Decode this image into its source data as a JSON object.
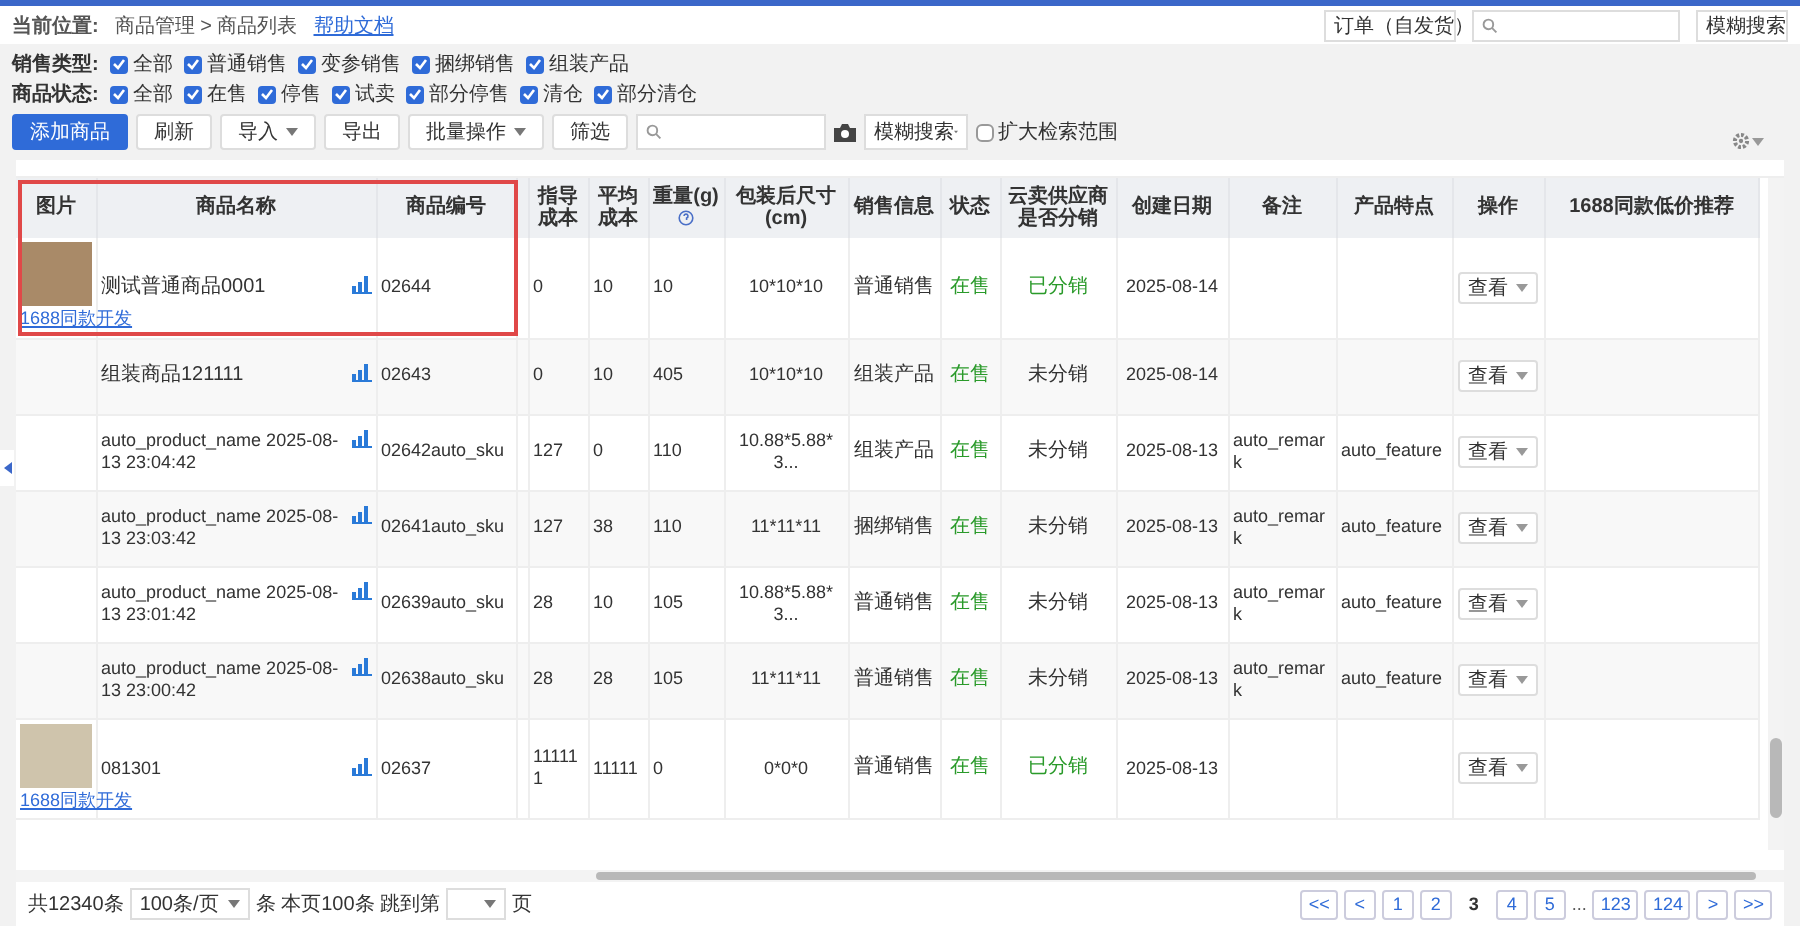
{
  "breadcrumb": {
    "label": "当前位置:",
    "path": "商品管理 > 商品列表",
    "help_link": "帮助文档"
  },
  "top_search": {
    "scope": "订单（自发货）",
    "mode": "模糊搜索"
  },
  "filters": [
    {
      "label": "销售类型:",
      "options": [
        {
          "text": "全部",
          "checked": true
        },
        {
          "text": "普通销售",
          "checked": true
        },
        {
          "text": "变参销售",
          "checked": true
        },
        {
          "text": "捆绑销售",
          "checked": true
        },
        {
          "text": "组装产品",
          "checked": true
        }
      ]
    },
    {
      "label": "商品状态:",
      "options": [
        {
          "text": "全部",
          "checked": true
        },
        {
          "text": "在售",
          "checked": true
        },
        {
          "text": "停售",
          "checked": true
        },
        {
          "text": "试卖",
          "checked": true
        },
        {
          "text": "部分停售",
          "checked": true
        },
        {
          "text": "清仓",
          "checked": true
        },
        {
          "text": "部分清仓",
          "checked": true
        }
      ]
    }
  ],
  "toolbar": {
    "buttons": [
      {
        "text": "添加商品",
        "kind": "primary"
      },
      {
        "text": "刷新",
        "kind": "plain"
      },
      {
        "text": "导入",
        "kind": "dropdown"
      },
      {
        "text": "导出",
        "kind": "plain"
      },
      {
        "text": "批量操作",
        "kind": "dropdown"
      },
      {
        "text": "筛选",
        "kind": "plain"
      }
    ],
    "search_mode": "模糊搜索",
    "expand": {
      "text": "扩大检索范围",
      "checked": false
    }
  },
  "table": {
    "columns": [
      {
        "label": "图片"
      },
      {
        "label": "商品名称"
      },
      {
        "label": "商品编号"
      },
      {},
      {
        "label": "指导成本"
      },
      {
        "label": "平均成本"
      },
      {
        "label": "重量(g)",
        "help": true
      },
      {
        "label": "包装后尺寸 (cm)"
      },
      {
        "label": "销售信息"
      },
      {
        "label": "状态"
      },
      {
        "label": "云卖供应商是否分销"
      },
      {
        "label": "创建日期"
      },
      {
        "label": "备注"
      },
      {
        "label": "产品特点"
      },
      {
        "label": "操作"
      },
      {
        "label": "1688同款低价推荐"
      }
    ],
    "rows": [
      {
        "photo": true,
        "link": "1688同款开发",
        "name": "测试普通商品0001",
        "sku": "02644",
        "guide_cost": "0",
        "avg_cost": "10",
        "weight": "10",
        "size": "10*10*10",
        "sales": "普通销售",
        "status": {
          "text": "在售",
          "on_sale": true
        },
        "distribution": {
          "text": "已分销",
          "distributed": true
        },
        "created": "2025-08-14",
        "action": "查看"
      },
      {
        "photo": false,
        "name": "组装商品121111",
        "sku": "02643",
        "guide_cost": "0",
        "avg_cost": "10",
        "weight": "405",
        "size": "10*10*10",
        "sales": "组装产品",
        "status": {
          "text": "在售",
          "on_sale": true
        },
        "distribution": {
          "text": "未分销",
          "distributed": false
        },
        "created": "2025-08-14",
        "action": "查看"
      },
      {
        "photo": false,
        "name": "auto_product_name 2025-08-13 23:04:42",
        "sku": "02642auto_sku",
        "guide_cost": "127",
        "avg_cost": "0",
        "weight": "110",
        "size": "10.88*5.88*3...",
        "sales": "组装产品",
        "status": {
          "text": "在售",
          "on_sale": true
        },
        "distribution": {
          "text": "未分销",
          "distributed": false
        },
        "created": "2025-08-13",
        "remark": "auto_remark",
        "feature": "auto_feature",
        "action": "查看"
      },
      {
        "photo": false,
        "name": "auto_product_name 2025-08-13 23:03:42",
        "sku": "02641auto_sku",
        "guide_cost": "127",
        "avg_cost": "38",
        "weight": "110",
        "size": "11*11*11",
        "sales": "捆绑销售",
        "status": {
          "text": "在售",
          "on_sale": true
        },
        "distribution": {
          "text": "未分销",
          "distributed": false
        },
        "created": "2025-08-13",
        "remark": "auto_remark",
        "feature": "auto_feature",
        "action": "查看"
      },
      {
        "photo": false,
        "name": "auto_product_name 2025-08-13 23:01:42",
        "sku": "02639auto_sku",
        "guide_cost": "28",
        "avg_cost": "10",
        "weight": "105",
        "size": "10.88*5.88*3...",
        "sales": "普通销售",
        "status": {
          "text": "在售",
          "on_sale": true
        },
        "distribution": {
          "text": "未分销",
          "distributed": false
        },
        "created": "2025-08-13",
        "remark": "auto_remark",
        "feature": "auto_feature",
        "action": "查看"
      },
      {
        "photo": false,
        "name": "auto_product_name 2025-08-13 23:00:42",
        "sku": "02638auto_sku",
        "guide_cost": "28",
        "avg_cost": "28",
        "weight": "105",
        "size": "11*11*11",
        "sales": "普通销售",
        "status": {
          "text": "在售",
          "on_sale": true
        },
        "distribution": {
          "text": "未分销",
          "distributed": false
        },
        "created": "2025-08-13",
        "remark": "auto_remark",
        "feature": "auto_feature",
        "action": "查看"
      },
      {
        "photo": true,
        "link": "1688同款开发",
        "name": "081301",
        "sku": "02637",
        "guide_cost": "111111",
        "avg_cost": "11111",
        "weight": "0",
        "size": "0*0*0",
        "sales": "普通销售",
        "status": {
          "text": "在售",
          "on_sale": true
        },
        "distribution": {
          "text": "已分销",
          "distributed": true
        },
        "created": "2025-08-13",
        "action": "查看"
      }
    ]
  },
  "pagination": {
    "total": "共12340条",
    "page_size": "100条/页",
    "per_page_text": "条 本页100条 跳到第",
    "page_suffix": "页",
    "pages": [
      {
        "text": "<<",
        "selected": false
      },
      {
        "text": "<",
        "selected": false
      },
      {
        "text": "1",
        "selected": false
      },
      {
        "text": "2",
        "selected": false
      },
      {
        "text": "3",
        "selected": true
      },
      {
        "text": "4",
        "selected": false
      },
      {
        "text": "5",
        "selected": false
      },
      {
        "text": "...",
        "kind": "gap"
      },
      {
        "text": "123",
        "selected": false
      },
      {
        "text": "124",
        "selected": false
      },
      {
        "text": ">",
        "selected": false
      },
      {
        "text": ">>",
        "selected": false
      }
    ]
  }
}
